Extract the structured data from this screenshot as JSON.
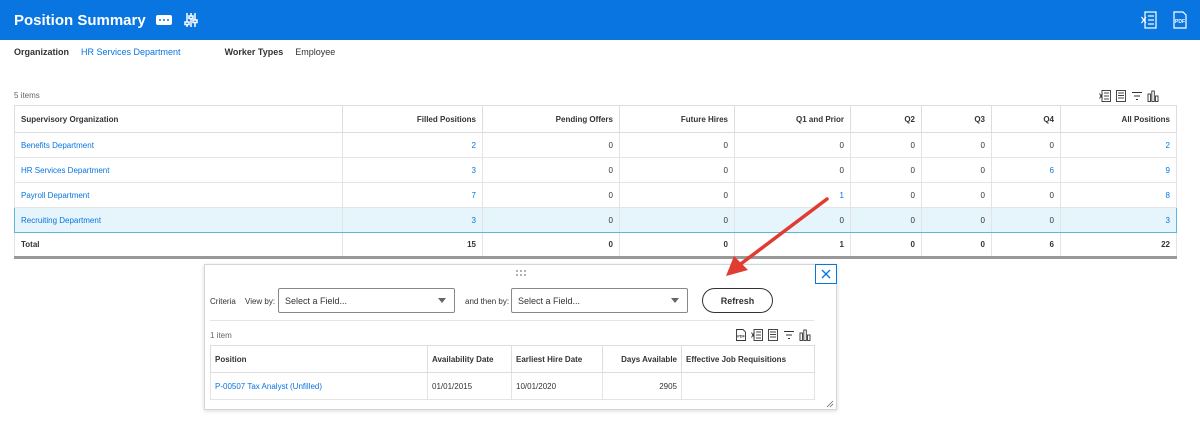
{
  "header": {
    "title": "Position Summary",
    "accent_color": "#0875e1"
  },
  "prompts": {
    "organization_label": "Organization",
    "organization_value": "HR Services Department",
    "worker_types_label": "Worker Types",
    "worker_types_value": "Employee"
  },
  "main_table": {
    "item_count": "5 items",
    "columns": [
      "Supervisory Organization",
      "Filled Positions",
      "Pending Offers",
      "Future Hires",
      "Q1 and Prior",
      "Q2",
      "Q3",
      "Q4",
      "All Positions"
    ],
    "rows": [
      [
        "Benefits Department",
        "2",
        "0",
        "0",
        "0",
        "0",
        "0",
        "0",
        "2"
      ],
      [
        "HR Services Department",
        "3",
        "0",
        "0",
        "0",
        "0",
        "0",
        "6",
        "9"
      ],
      [
        "Payroll Department",
        "7",
        "0",
        "0",
        "1",
        "0",
        "0",
        "0",
        "8"
      ],
      [
        "Recruiting Department",
        "3",
        "0",
        "0",
        "0",
        "0",
        "0",
        "0",
        "3"
      ]
    ],
    "total": [
      "Total",
      "15",
      "0",
      "0",
      "1",
      "0",
      "0",
      "6",
      "22"
    ]
  },
  "popup": {
    "criteria_label": "Criteria",
    "view_by_label": "View by:",
    "view_by_value": "Select a Field...",
    "then_by_label": "and then by:",
    "then_by_value": "Select a Field...",
    "refresh_label": "Refresh",
    "item_count": "1 item",
    "columns": [
      "Position",
      "Availability Date",
      "Earliest Hire Date",
      "Days Available",
      "Effective Job Requisitions"
    ],
    "rows": [
      [
        "P-00507 Tax Analyst (Unfilled)",
        "01/01/2015",
        "10/01/2020",
        "2905",
        ""
      ]
    ]
  }
}
